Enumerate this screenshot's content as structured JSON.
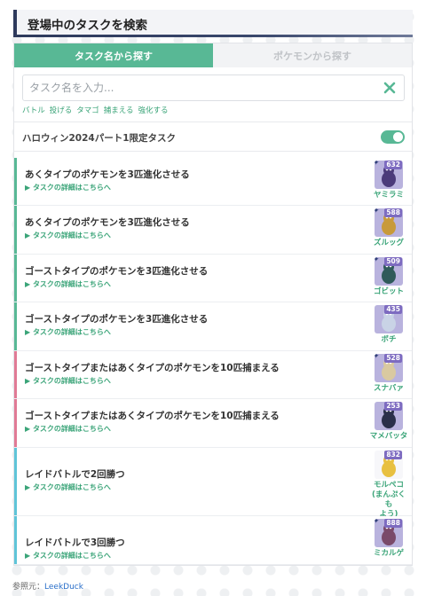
{
  "header": {
    "title": "登場中のタスクを検索"
  },
  "tabs": [
    {
      "label": "タスク名から探す",
      "active": true
    },
    {
      "label": "ポケモンから探す",
      "active": false
    }
  ],
  "search": {
    "placeholder": "タスク名を入力...",
    "value": ""
  },
  "quick_tags": [
    "バトル",
    "投げる",
    "タマゴ",
    "捕まえる",
    "強化する"
  ],
  "filter": {
    "label": "ハロウィン2024パート1限定タスク",
    "enabled": true
  },
  "detail_link_text": "▶ タスクの詳細はこちらへ",
  "tasks": [
    {
      "name": "あくタイプのポケモンを3匹進化させる",
      "link": "▶ タスクの詳細はこちらへ",
      "reward": {
        "name": "ヤミラミ",
        "cp": "632",
        "shiny": true
      },
      "stripe": "#58b895"
    },
    {
      "name": "あくタイプのポケモンを3匹進化させる",
      "link": "▶ タスクの詳細はこちらへ",
      "reward": {
        "name": "ズルッグ",
        "cp": "588",
        "shiny": true
      },
      "stripe": "#58b895"
    },
    {
      "name": "ゴーストタイプのポケモンを3匹進化させる",
      "link": "▶ タスクの詳細はこちらへ",
      "reward": {
        "name": "ゴビット",
        "cp": "509",
        "shiny": true
      },
      "stripe": "#58b895"
    },
    {
      "name": "ゴーストタイプのポケモンを3匹進化させる",
      "link": "▶ タスクの詳細はこちらへ",
      "reward": {
        "name": "ボチ",
        "cp": "435",
        "shiny": false
      },
      "stripe": "#58b895"
    },
    {
      "name": "ゴーストタイプまたはあくタイプのポケモンを10匹捕まえる",
      "link": "▶ タスクの詳細はこちらへ",
      "reward": {
        "name": "スナバァ",
        "cp": "528",
        "shiny": true
      },
      "stripe": "#e07a95"
    },
    {
      "name": "ゴーストタイプまたはあくタイプのポケモンを10匹捕まえる",
      "link": "▶ タスクの詳細はこちらへ",
      "reward": {
        "name": "マメバッタ",
        "cp": "253",
        "shiny": false
      },
      "stripe": "#e07a95"
    },
    {
      "name": "レイドバトルで2回勝つ",
      "link": "▶ タスクの詳細はこちらへ",
      "reward": {
        "name": "モルペコ(まんぷくもよう)",
        "name_lines": [
          "モルペコ",
          "(まんぷくも",
          "よう)"
        ],
        "cp": "832",
        "shiny": false
      },
      "stripe": "#5fc4d8"
    },
    {
      "name": "レイドバトルで3回勝つ",
      "link": "▶ タスクの詳細はこちらへ",
      "reward": {
        "name": "ミカルゲ",
        "cp": "888",
        "shiny": true
      },
      "stripe": "#5fc4d8"
    }
  ],
  "footer": {
    "label": "参照元：",
    "link": "LeekDuck"
  },
  "colors": {
    "accent": "#58b895",
    "link": "#3aa478",
    "badge": "#7d6bc0",
    "pink": "#e07a95",
    "cyan": "#5fc4d8"
  },
  "icons": [
    "clear-x-icon",
    "sparkle-icon",
    "toggle-switch"
  ]
}
